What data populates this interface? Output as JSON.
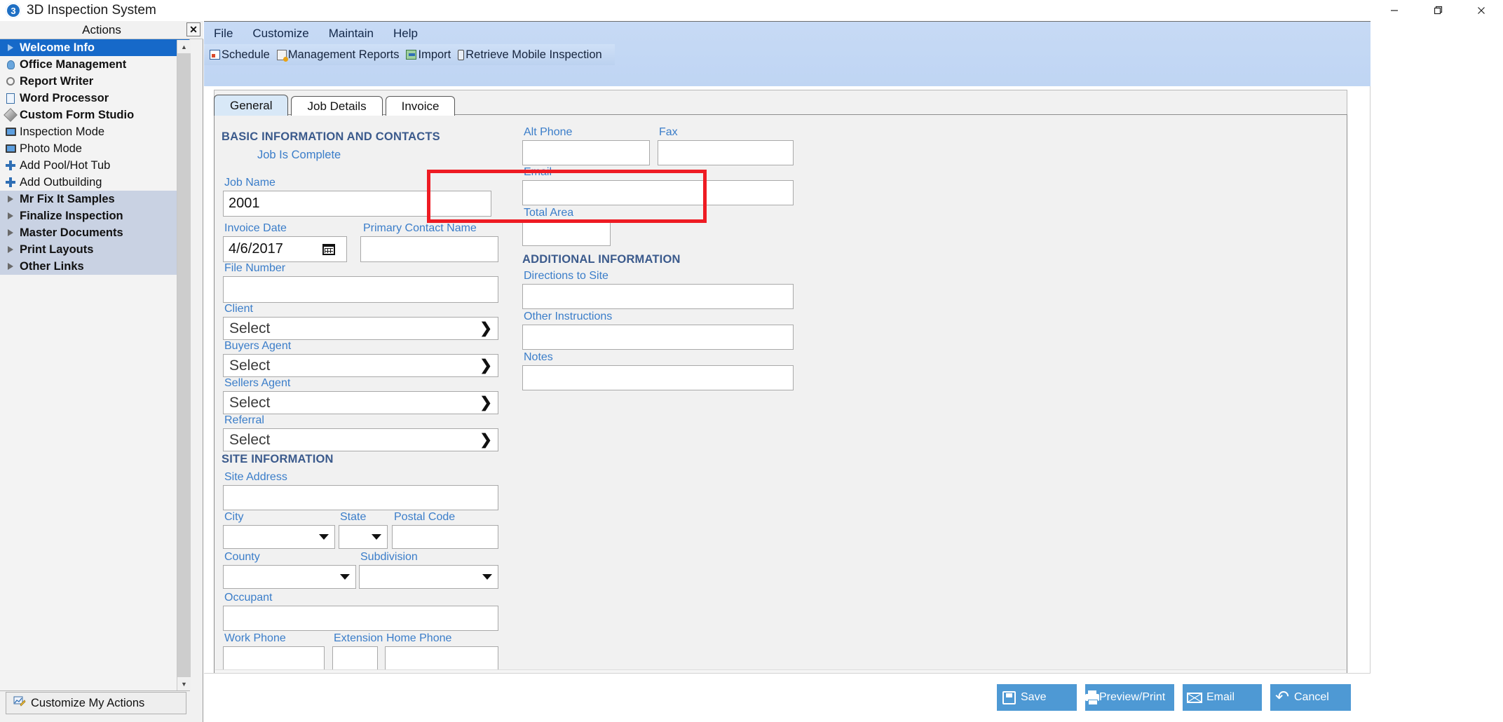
{
  "window": {
    "title": "3D Inspection System",
    "app_icon": "3d-app-icon",
    "minimize": "minimize-icon",
    "maximize": "maximize-icon",
    "close": "close-icon"
  },
  "actions_panel": {
    "header": "Actions",
    "close_label": "✕",
    "customize_label": "Customize My Actions",
    "items": [
      {
        "label": "Welcome Info",
        "icon": "arrow-icon",
        "selected": true,
        "bold": true,
        "group": false
      },
      {
        "label": "Office Management",
        "icon": "person-icon",
        "selected": false,
        "bold": true,
        "group": false
      },
      {
        "label": "Report Writer",
        "icon": "magnifier-icon",
        "selected": false,
        "bold": true,
        "group": false
      },
      {
        "label": "Word Processor",
        "icon": "document-icon",
        "selected": false,
        "bold": true,
        "group": false
      },
      {
        "label": "Custom Form Studio",
        "icon": "pen-icon",
        "selected": false,
        "bold": true,
        "group": false
      },
      {
        "label": "Inspection Mode",
        "icon": "monitor-icon",
        "selected": false,
        "bold": false,
        "group": false
      },
      {
        "label": "Photo Mode",
        "icon": "monitor-icon",
        "selected": false,
        "bold": false,
        "group": false
      },
      {
        "label": "Add Pool/Hot Tub",
        "icon": "plus-icon",
        "selected": false,
        "bold": false,
        "group": false
      },
      {
        "label": "Add Outbuilding",
        "icon": "plus-icon",
        "selected": false,
        "bold": false,
        "group": false
      },
      {
        "label": "Mr Fix It Samples",
        "icon": "arrow-icon",
        "selected": false,
        "bold": true,
        "group": true
      },
      {
        "label": "Finalize Inspection",
        "icon": "arrow-icon",
        "selected": false,
        "bold": true,
        "group": true
      },
      {
        "label": "Master Documents",
        "icon": "arrow-icon",
        "selected": false,
        "bold": true,
        "group": true
      },
      {
        "label": "Print Layouts",
        "icon": "arrow-icon",
        "selected": false,
        "bold": true,
        "group": true
      },
      {
        "label": "Other Links",
        "icon": "arrow-icon",
        "selected": false,
        "bold": true,
        "group": true
      }
    ]
  },
  "menubar": {
    "items": [
      "File",
      "Customize",
      "Maintain",
      "Help"
    ]
  },
  "toolbar": {
    "items": [
      {
        "label": "Schedule",
        "icon": "calendar-icon"
      },
      {
        "label": "Management Reports",
        "icon": "report-icon"
      },
      {
        "label": "Import",
        "icon": "import-icon"
      },
      {
        "label": "Retrieve Mobile Inspection",
        "icon": "mobile-icon"
      }
    ]
  },
  "tabs": [
    {
      "label": "General",
      "active": true
    },
    {
      "label": "Job Details",
      "active": false
    },
    {
      "label": "Invoice",
      "active": false
    }
  ],
  "form": {
    "sections": {
      "basic": "BASIC INFORMATION AND CONTACTS",
      "site": "SITE INFORMATION",
      "additional": "ADDITIONAL INFORMATION"
    },
    "job_is_complete": {
      "label": "Job Is Complete",
      "checked": false
    },
    "job_name": {
      "label": "Job Name",
      "value": "2001",
      "highlighted": true
    },
    "invoice_date": {
      "label": "Invoice Date",
      "value": "4/6/2017"
    },
    "primary_contact": {
      "label": "Primary Contact Name",
      "value": ""
    },
    "file_number": {
      "label": "File Number",
      "value": ""
    },
    "client": {
      "label": "Client",
      "value": "Select"
    },
    "buyers_agent": {
      "label": "Buyers Agent",
      "value": "Select"
    },
    "sellers_agent": {
      "label": "Sellers Agent",
      "value": "Select"
    },
    "referral": {
      "label": "Referral",
      "value": "Select"
    },
    "site_address": {
      "label": "Site Address",
      "value": ""
    },
    "city": {
      "label": "City",
      "value": ""
    },
    "state": {
      "label": "State",
      "value": ""
    },
    "postal_code": {
      "label": "Postal Code",
      "value": ""
    },
    "county": {
      "label": "County",
      "value": ""
    },
    "subdivision": {
      "label": "Subdivision",
      "value": ""
    },
    "occupant": {
      "label": "Occupant",
      "value": ""
    },
    "work_phone": {
      "label": "Work Phone",
      "value": ""
    },
    "extension": {
      "label": "Extension",
      "value": ""
    },
    "home_phone": {
      "label": "Home Phone",
      "value": ""
    },
    "alt_phone": {
      "label": "Alt Phone",
      "value": ""
    },
    "fax": {
      "label": "Fax",
      "value": ""
    },
    "email": {
      "label": "Email",
      "value": ""
    },
    "total_area": {
      "label": "Total Area",
      "value": ""
    },
    "directions": {
      "label": "Directions to Site",
      "value": ""
    },
    "other_instructions": {
      "label": "Other Instructions",
      "value": ""
    },
    "notes": {
      "label": "Notes",
      "value": ""
    }
  },
  "footer_buttons": [
    {
      "label": "Save",
      "icon": "save-icon"
    },
    {
      "label": "Preview/Print",
      "icon": "printer-icon"
    },
    {
      "label": "Email",
      "icon": "envelope-icon"
    },
    {
      "label": "Cancel",
      "icon": "undo-icon"
    }
  ],
  "colors": {
    "accent_blue": "#4e99d4",
    "label_blue": "#3a7dc9",
    "section_blue": "#3b5a8c",
    "highlight_red": "#ee1b23",
    "selected_item": "#1669c9",
    "header_blue": "#c7daf5"
  }
}
